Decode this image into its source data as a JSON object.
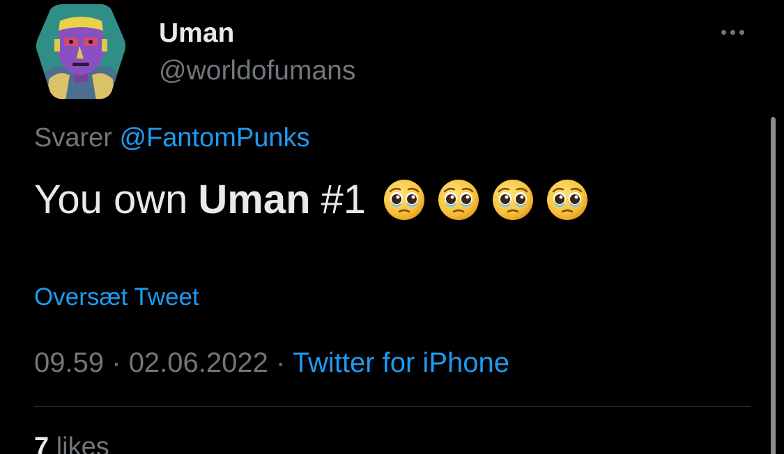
{
  "author": {
    "name": "Uman",
    "handle": "@worldofumans",
    "avatar_icon": "uman-nft-avatar"
  },
  "more_icon": "more-horizontal-icon",
  "reply": {
    "prefix": "Svarer",
    "mention": "@FantomPunks"
  },
  "tweet": {
    "text_before": "You own",
    "bold_text": "Uman",
    "text_after": "#1",
    "emojis": [
      "🥹",
      "🥹",
      "🥹",
      "🥹"
    ],
    "emoji_icon": "pleading-face-with-tears-emoji"
  },
  "translate_label": "Oversæt Tweet",
  "meta": {
    "time": "09.59",
    "separator": "·",
    "date": "02.06.2022",
    "source": "Twitter for iPhone"
  },
  "likes": {
    "count": "7",
    "label": "likes"
  },
  "colors": {
    "background": "#000000",
    "primary_text": "#e7e9ea",
    "secondary_text": "#71767b",
    "accent": "#1d9bf0",
    "divider": "#2f3336"
  }
}
